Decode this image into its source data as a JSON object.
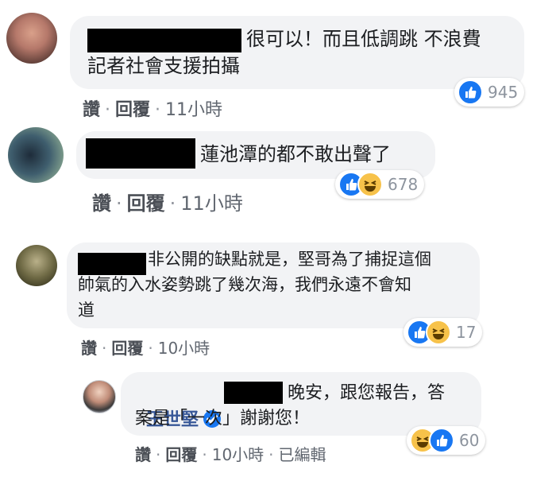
{
  "comments": [
    {
      "text": "很可以！而且低調跳 不浪費\n記者社會支援拍攝",
      "actions": {
        "like": "讚",
        "reply": "回覆",
        "time": "11小時"
      },
      "reaction_count": "945",
      "reactions": [
        "like-icon"
      ]
    },
    {
      "text": "蓮池潭的都不敢出聲了",
      "actions": {
        "like": "讚",
        "reply": "回覆",
        "time": "11小時"
      },
      "reaction_count": "678",
      "reactions": [
        "like-icon",
        "haha-icon"
      ]
    },
    {
      "text": "非公開的缺點就是，堅哥為了捕捉這個\n帥氣的入水姿勢跳了幾次海，我們永遠不會知\n道",
      "actions": {
        "like": "讚",
        "reply": "回覆",
        "time": "10小時"
      },
      "reaction_count": "17",
      "reactions": [
        "like-icon",
        "haha-icon"
      ]
    }
  ],
  "reply": {
    "author": "王世堅",
    "verified_icon": "verified-badge-icon",
    "text_line1": "晚安，跟您報告，答",
    "text_line2": "案是「一次」謝謝您！",
    "actions": {
      "like": "讚",
      "reply": "回覆",
      "time": "10小時",
      "edited": "已編輯"
    },
    "reaction_count": "60",
    "reactions": [
      "haha-icon",
      "like-icon"
    ]
  },
  "colors": {
    "bubble": "#f2f3f5",
    "link": "#385898",
    "like": "#1877f2",
    "haha": "#f7c24a"
  }
}
